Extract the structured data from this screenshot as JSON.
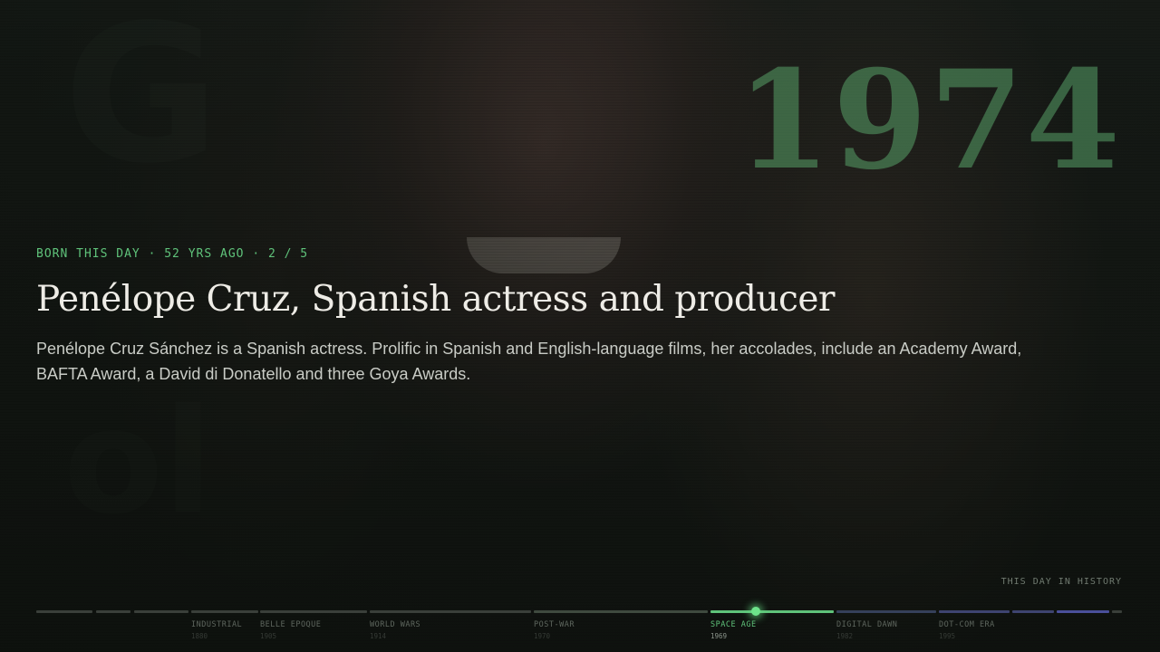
{
  "event": {
    "kicker": "BORN THIS DAY · 52 YRS AGO · 2 / 5",
    "title": "Penélope Cruz, Spanish actress and producer",
    "description": "Penélope Cruz Sánchez is a Spanish actress. Prolific in Spanish and English-language films, her accolades, include an Academy Award, BAFTA Award, a David di Donatello and three Goya Awards.",
    "year": "1974"
  },
  "tagline": "THIS DAY IN HISTORY",
  "timeline": {
    "eras": [
      {
        "label": "INDUSTRIAL",
        "year": "1880"
      },
      {
        "label": "BELLE EPOQUE",
        "year": "1905"
      },
      {
        "label": "WORLD WARS",
        "year": "1914"
      },
      {
        "label": "POST-WAR",
        "year": "1970"
      },
      {
        "label": "SPACE AGE",
        "year": "1969"
      },
      {
        "label": "DIGITAL DAWN",
        "year": "1982"
      },
      {
        "label": "DOT-COM ERA",
        "year": "1995"
      }
    ],
    "active_era_index": 4,
    "accent_color": "#5fc27a",
    "tail_color": "#4a4f9a"
  }
}
